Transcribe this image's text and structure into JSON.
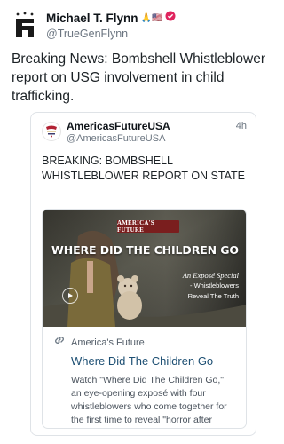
{
  "post": {
    "author_name": "Michael T. Flynn",
    "author_emojis": "🙏🇺🇸",
    "verified_icon": "verified-badge-icon",
    "handle": "@TrueGenFlynn",
    "text": "Breaking News: Bombshell Whistleblower report on USG involvement in child trafficking."
  },
  "quoted": {
    "author_name": "AmericasFutureUSA",
    "handle": "@AmericasFutureUSA",
    "time": "4h",
    "text": "BREAKING: BOMBSHELL WHISTLEBLOWER REPORT ON STATE SPONSORED CHILD T..."
  },
  "link_card": {
    "image_brand": "AMERICA'S FUTURE",
    "image_title": "WHERE DID THE CHILDREN GO",
    "image_subtitle": "An Exposé Special",
    "image_caption_1": "- Whistleblowers",
    "image_caption_2": "Reveal The Truth",
    "domain": "America's Future",
    "title": "Where Did The Children Go",
    "description": "Watch \"Where Did The Children Go,\" an eye-opening exposé with four whistleblowers who come together for the first time to reveal \"horror after"
  },
  "colors": {
    "verified": "#e0245e",
    "link_title": "#1d4f73",
    "brand_bar": "#7a1e1e"
  }
}
